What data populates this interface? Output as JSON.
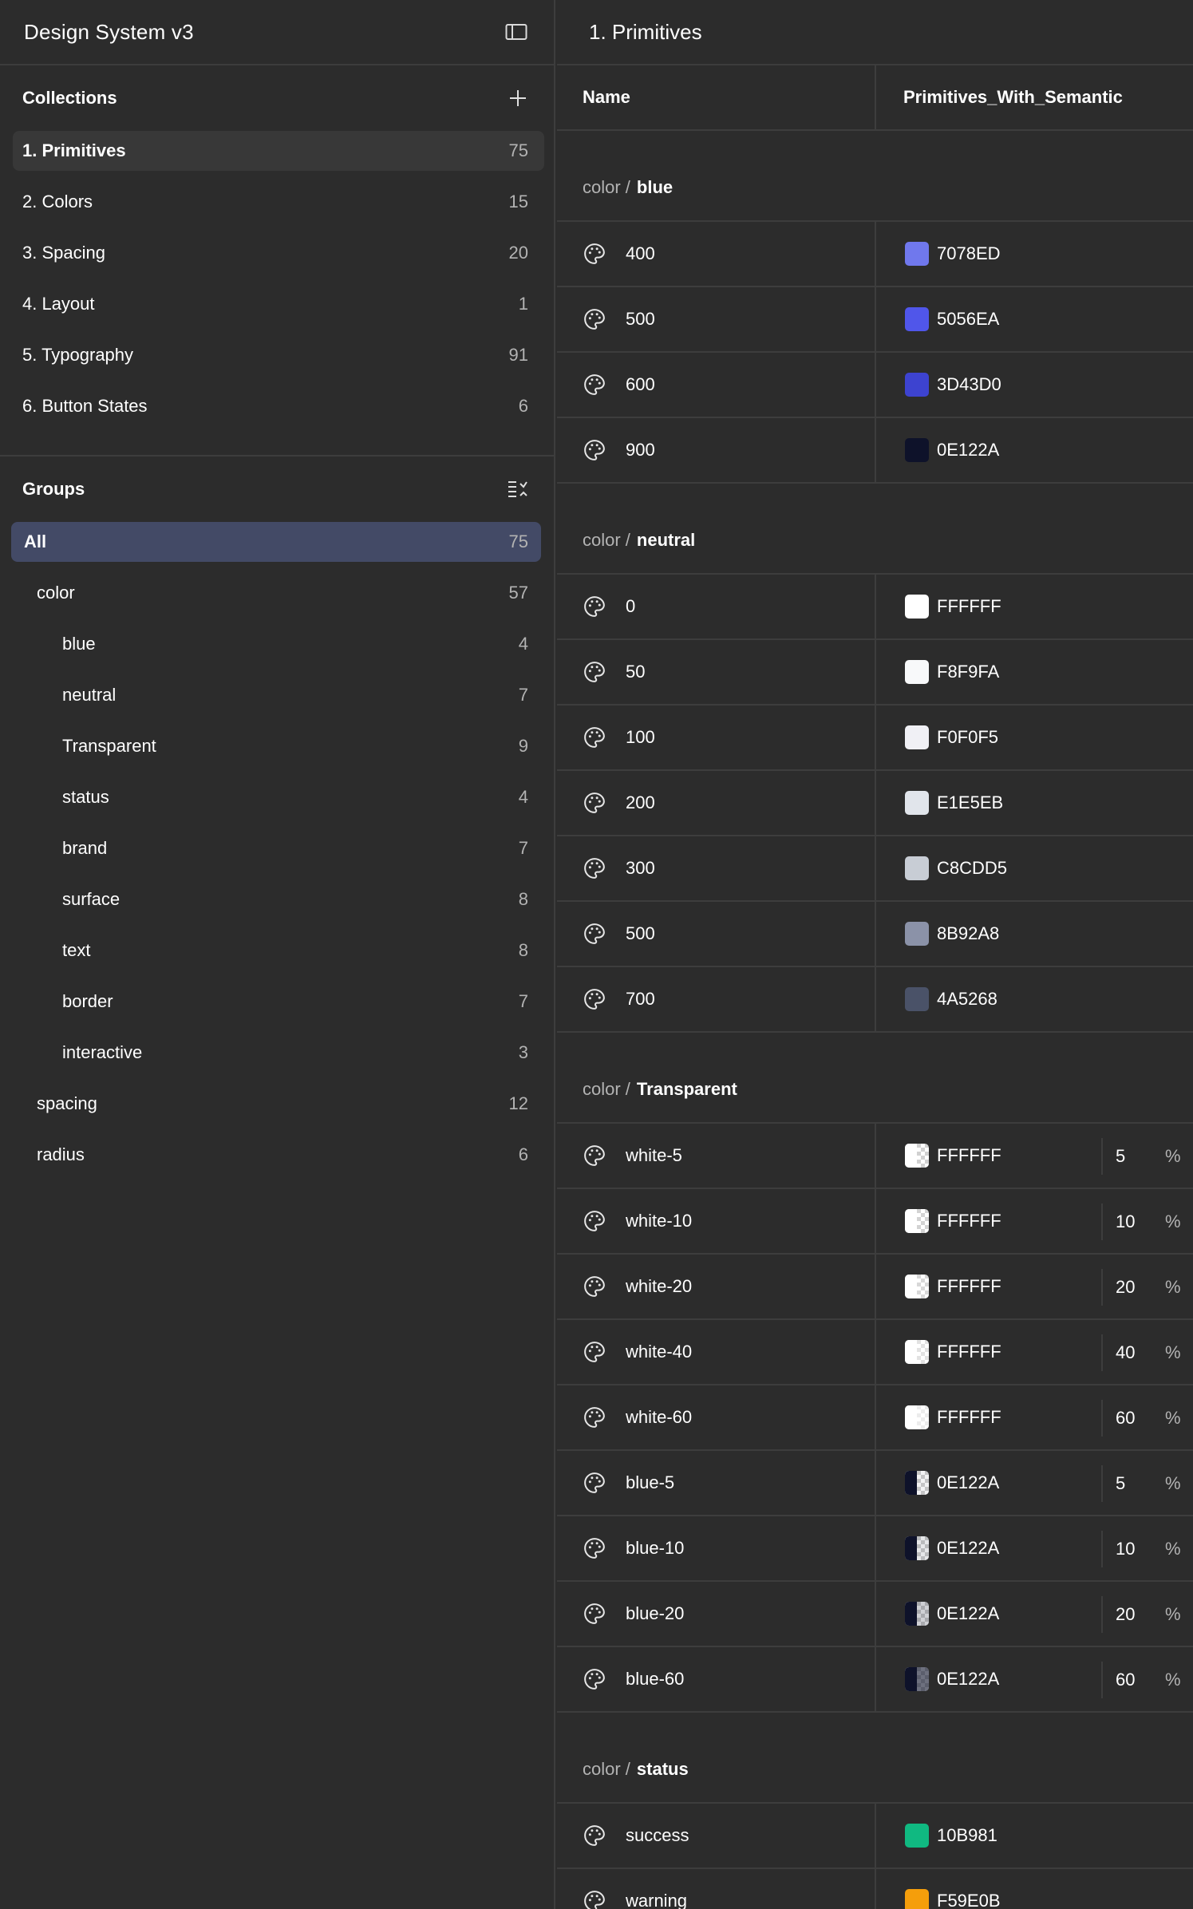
{
  "app": {
    "title": "Design System v3"
  },
  "collections": {
    "title": "Collections",
    "items": [
      {
        "label": "1. Primitives",
        "count": "75",
        "active": true
      },
      {
        "label": "2. Colors",
        "count": "15"
      },
      {
        "label": "3. Spacing",
        "count": "20"
      },
      {
        "label": "4. Layout",
        "count": "1"
      },
      {
        "label": "5. Typography",
        "count": "91"
      },
      {
        "label": "6. Button States",
        "count": "6"
      }
    ]
  },
  "groups": {
    "title": "Groups",
    "items": [
      {
        "label": "All",
        "count": "75",
        "level": 0,
        "active": true
      },
      {
        "label": "color",
        "count": "57",
        "level": 1
      },
      {
        "label": "blue",
        "count": "4",
        "level": 2
      },
      {
        "label": "neutral",
        "count": "7",
        "level": 2
      },
      {
        "label": "Transparent",
        "count": "9",
        "level": 2
      },
      {
        "label": "status",
        "count": "4",
        "level": 2
      },
      {
        "label": "brand",
        "count": "7",
        "level": 2
      },
      {
        "label": "surface",
        "count": "8",
        "level": 2
      },
      {
        "label": "text",
        "count": "8",
        "level": 2
      },
      {
        "label": "border",
        "count": "7",
        "level": 2
      },
      {
        "label": "interactive",
        "count": "3",
        "level": 2
      },
      {
        "label": "spacing",
        "count": "12",
        "level": 1
      },
      {
        "label": "radius",
        "count": "6",
        "level": 1
      }
    ]
  },
  "main": {
    "title": "1. Primitives",
    "columns": {
      "name": "Name",
      "mode": "Primitives_With_Semantic"
    },
    "sections": [
      {
        "prefix": "color /",
        "name": "blue",
        "rows": [
          {
            "name": "400",
            "hex": "7078ED",
            "color": "#7078ED"
          },
          {
            "name": "500",
            "hex": "5056EA",
            "color": "#5056EA"
          },
          {
            "name": "600",
            "hex": "3D43D0",
            "color": "#3D43D0"
          },
          {
            "name": "900",
            "hex": "0E122A",
            "color": "#0E122A"
          }
        ]
      },
      {
        "prefix": "color /",
        "name": "neutral",
        "rows": [
          {
            "name": "0",
            "hex": "FFFFFF",
            "color": "#FFFFFF"
          },
          {
            "name": "50",
            "hex": "F8F9FA",
            "color": "#F8F9FA"
          },
          {
            "name": "100",
            "hex": "F0F0F5",
            "color": "#F0F0F5"
          },
          {
            "name": "200",
            "hex": "E1E5EB",
            "color": "#E1E5EB"
          },
          {
            "name": "300",
            "hex": "C8CDD5",
            "color": "#C8CDD5"
          },
          {
            "name": "500",
            "hex": "8B92A8",
            "color": "#8B92A8"
          },
          {
            "name": "700",
            "hex": "4A5268",
            "color": "#4A5268"
          }
        ]
      },
      {
        "prefix": "color /",
        "name": "Transparent",
        "rows": [
          {
            "name": "white-5",
            "hex": "FFFFFF",
            "color": "#FFFFFF",
            "alpha": "5",
            "unit": "%"
          },
          {
            "name": "white-10",
            "hex": "FFFFFF",
            "color": "#FFFFFF",
            "alpha": "10",
            "unit": "%"
          },
          {
            "name": "white-20",
            "hex": "FFFFFF",
            "color": "#FFFFFF",
            "alpha": "20",
            "unit": "%"
          },
          {
            "name": "white-40",
            "hex": "FFFFFF",
            "color": "#FFFFFF",
            "alpha": "40",
            "unit": "%"
          },
          {
            "name": "white-60",
            "hex": "FFFFFF",
            "color": "#FFFFFF",
            "alpha": "60",
            "unit": "%"
          },
          {
            "name": "blue-5",
            "hex": "0E122A",
            "color": "#0E122A",
            "alpha": "5",
            "unit": "%"
          },
          {
            "name": "blue-10",
            "hex": "0E122A",
            "color": "#0E122A",
            "alpha": "10",
            "unit": "%"
          },
          {
            "name": "blue-20",
            "hex": "0E122A",
            "color": "#0E122A",
            "alpha": "20",
            "unit": "%"
          },
          {
            "name": "blue-60",
            "hex": "0E122A",
            "color": "#0E122A",
            "alpha": "60",
            "unit": "%"
          }
        ]
      },
      {
        "prefix": "color /",
        "name": "status",
        "rows": [
          {
            "name": "success",
            "hex": "10B981",
            "color": "#10B981"
          },
          {
            "name": "warning",
            "hex": "F59E0B",
            "color": "#F59E0B"
          }
        ]
      }
    ]
  }
}
